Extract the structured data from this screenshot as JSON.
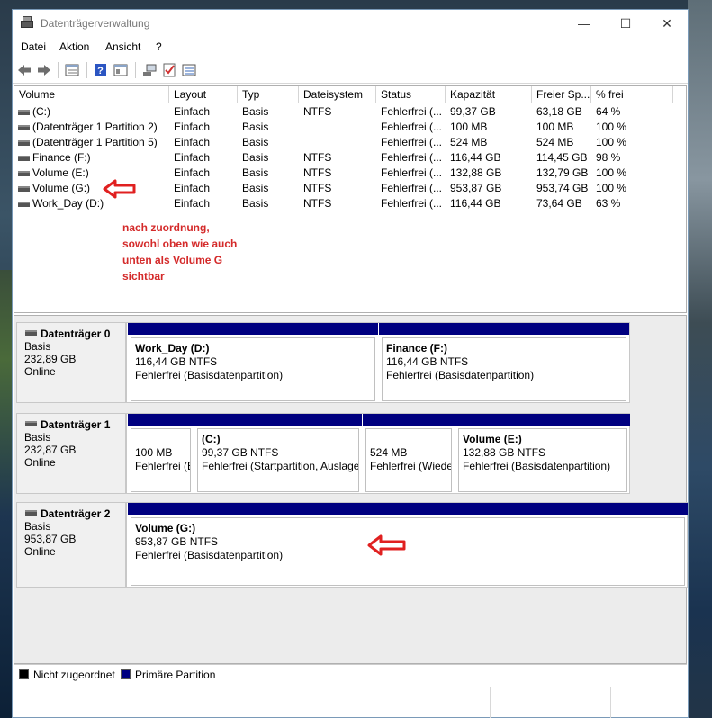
{
  "window": {
    "title": "Datenträgerverwaltung",
    "minimize": "—",
    "maximize": "☐",
    "close": "✕"
  },
  "menu": [
    "Datei",
    "Aktion",
    "Ansicht",
    "?"
  ],
  "toolbar": [
    "back-icon",
    "forward-icon",
    "properties-icon",
    "help-icon",
    "view-icon",
    "connect-icon",
    "check-icon",
    "list-icon"
  ],
  "columns": [
    "Volume",
    "Layout",
    "Typ",
    "Dateisystem",
    "Status",
    "Kapazität",
    "Freier Sp...",
    "% frei"
  ],
  "volumes": [
    {
      "name": " (C:)",
      "layout": "Einfach",
      "type": "Basis",
      "fs": "NTFS",
      "status": "Fehlerfrei (...",
      "capacity": "99,37 GB",
      "free": "63,18 GB",
      "pct": "64 %"
    },
    {
      "name": "(Datenträger 1 Partition 2)",
      "layout": "Einfach",
      "type": "Basis",
      "fs": "",
      "status": "Fehlerfrei (...",
      "capacity": "100 MB",
      "free": "100 MB",
      "pct": "100 %"
    },
    {
      "name": "(Datenträger 1 Partition 5)",
      "layout": "Einfach",
      "type": "Basis",
      "fs": "",
      "status": "Fehlerfrei (...",
      "capacity": "524 MB",
      "free": "524 MB",
      "pct": "100 %"
    },
    {
      "name": "Finance (F:)",
      "layout": "Einfach",
      "type": "Basis",
      "fs": "NTFS",
      "status": "Fehlerfrei (...",
      "capacity": "116,44 GB",
      "free": "114,45 GB",
      "pct": "98 %"
    },
    {
      "name": "Volume (E:)",
      "layout": "Einfach",
      "type": "Basis",
      "fs": "NTFS",
      "status": "Fehlerfrei (...",
      "capacity": "132,88 GB",
      "free": "132,79 GB",
      "pct": "100 %"
    },
    {
      "name": "Volume (G:)",
      "layout": "Einfach",
      "type": "Basis",
      "fs": "NTFS",
      "status": "Fehlerfrei (...",
      "capacity": "953,87 GB",
      "free": "953,74 GB",
      "pct": "100 %"
    },
    {
      "name": "Work_Day (D:)",
      "layout": "Einfach",
      "type": "Basis",
      "fs": "NTFS",
      "status": "Fehlerfrei (...",
      "capacity": "116,44 GB",
      "free": "73,64 GB",
      "pct": "63 %"
    }
  ],
  "annotation": [
    "nach zuordnung,",
    "sowohl oben wie auch",
    "unten als Volume G",
    "sichtbar"
  ],
  "disks": [
    {
      "name": "Datenträger 0",
      "type": "Basis",
      "size": "232,89 GB",
      "state": "Online",
      "parts": [
        {
          "title": "Work_Day  (D:)",
          "size": "116,44 GB NTFS",
          "status": "Fehlerfrei (Basisdatenpartition)"
        },
        {
          "title": "Finance  (F:)",
          "size": "116,44 GB NTFS",
          "status": "Fehlerfrei (Basisdatenpartition)"
        }
      ]
    },
    {
      "name": "Datenträger 1",
      "type": "Basis",
      "size": "232,87 GB",
      "state": "Online",
      "parts": [
        {
          "title": "",
          "size": "100 MB",
          "status": "Fehlerfrei (E"
        },
        {
          "title": " (C:)",
          "size": "99,37 GB NTFS",
          "status": "Fehlerfrei (Startpartition, Auslage"
        },
        {
          "title": "",
          "size": "524 MB",
          "status": "Fehlerfrei (Wiede"
        },
        {
          "title": "Volume  (E:)",
          "size": "132,88 GB NTFS",
          "status": "Fehlerfrei (Basisdatenpartition)"
        }
      ]
    },
    {
      "name": "Datenträger 2",
      "type": "Basis",
      "size": "953,87 GB",
      "state": "Online",
      "parts": [
        {
          "title": "Volume  (G:)",
          "size": "953,87 GB NTFS",
          "status": "Fehlerfrei (Basisdatenpartition)"
        }
      ]
    }
  ],
  "legend": [
    {
      "label": "Nicht zugeordnet",
      "color": "#000000"
    },
    {
      "label": "Primäre Partition",
      "color": "#000080"
    }
  ],
  "colors": {
    "partition_bar": "#000080",
    "annotation": "#d42a2a"
  }
}
